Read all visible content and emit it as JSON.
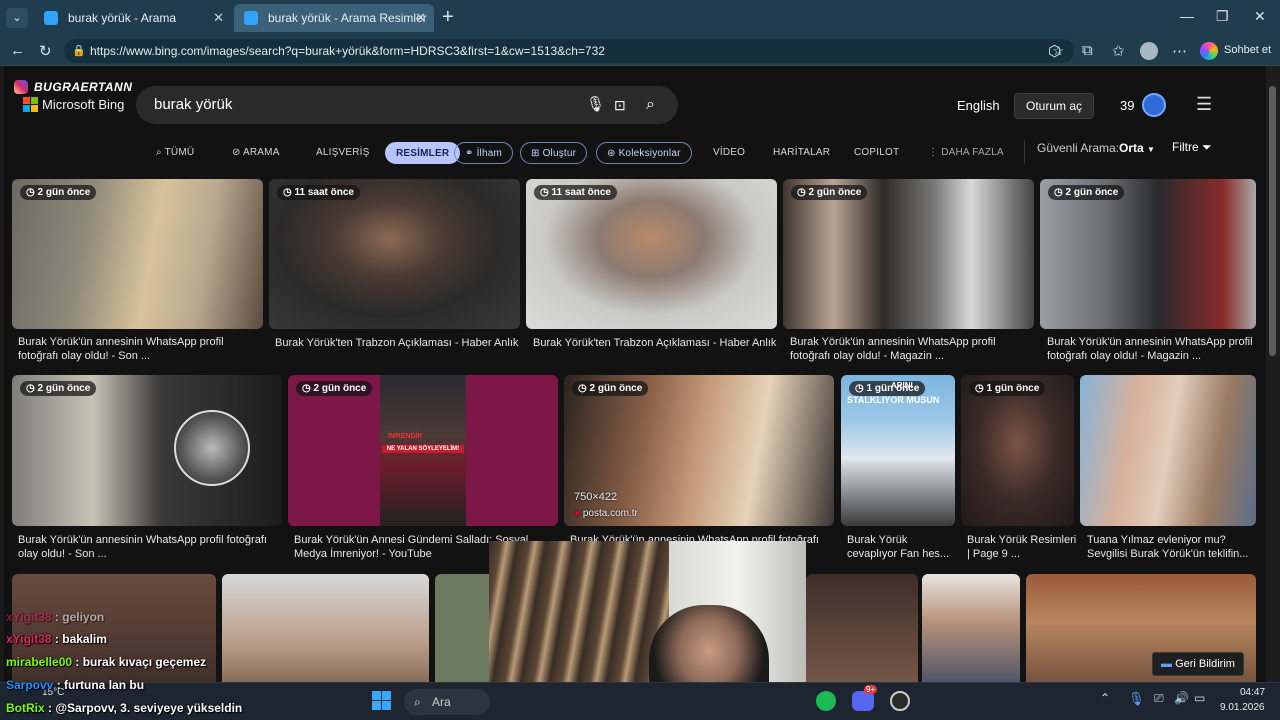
{
  "browser": {
    "tabs": [
      {
        "label": "burak yörük - Arama"
      },
      {
        "label": "burak yörük - Arama Resimler"
      }
    ],
    "url": "https://www.bing.com/images/search?q=burak+yörük&form=HDRSC3&first=1&cw=1513&ch=732",
    "copilot_label": "Sohbet et"
  },
  "overlay": {
    "streamer_name": "BUGRAERTANN"
  },
  "bing": {
    "logo_text": "Microsoft Bing",
    "search_query": "burak yörük",
    "language_link": "English",
    "signin_button": "Oturum aç",
    "rewards_count": "39",
    "nav": {
      "all": "TÜMÜ",
      "search": "ARAMA",
      "shopping": "ALIŞVERİŞ",
      "images": "RESİMLER",
      "inspiration": "İlham",
      "create": "Oluştur",
      "collections": "Koleksiyonlar",
      "video": "VİDEO",
      "maps": "HARİTALAR",
      "copilot": "COPILOT",
      "more": "DAHA FAZLA"
    },
    "safesearch_label": "Güvenli Arama:",
    "safesearch_value": "Orta",
    "filter_label": "Filtre"
  },
  "results_row1": [
    {
      "badge": "2 gün önce",
      "caption": "Burak Yörük'ün annesinin WhatsApp profil fotoğrafı olay oldu! - Son ..."
    },
    {
      "badge": "11 saat önce",
      "caption": "Burak Yörük'ten Trabzon Açıklaması - Haber Anlık"
    },
    {
      "badge": "11 saat önce",
      "caption": "Burak Yörük'ten Trabzon Açıklaması - Haber Anlık"
    },
    {
      "badge": "2 gün önce",
      "caption": "Burak Yörük'ün annesinin WhatsApp profil fotoğrafı olay oldu! - Magazin ..."
    },
    {
      "badge": "2 gün önce",
      "caption": "Burak Yörük'ün annesinin WhatsApp profil fotoğrafı olay oldu! - Magazin ..."
    }
  ],
  "results_row2": [
    {
      "badge": "2 gün önce",
      "caption": "Burak Yörük'ün annesinin WhatsApp profil fotoğrafı olay oldu! - Son ..."
    },
    {
      "badge": "2 gün önce",
      "caption": "Burak Yörük'ün Annesi Gündemi Salladı: Sosyal Medya İmreniyor! - YouTube"
    },
    {
      "badge": "2 gün önce",
      "caption": "Burak Yörük'ün annesinin WhatsApp profil fotoğrafı",
      "dimensions": "750×422",
      "source": "posta.com.tr"
    },
    {
      "badge": "1 gün önce",
      "caption": "Burak Yörük cevaplıyor Fan hes..."
    },
    {
      "badge": "1 gün önce",
      "caption": "Burak Yörük Resimleri | Page 9 ..."
    },
    {
      "badge": "",
      "caption": "Tuana Yılmaz evleniyor mu? Sevgilisi Burak Yörük'ün teklifin..."
    }
  ],
  "thumb_texts": {
    "ne_yalan": "NE YALAN SÖYLEYELİM!",
    "imrendik": "İMRENDİK",
    "stalkliyor": "STALKLIYOR MUSUN",
    "arini": "ARINI"
  },
  "feedback_button": "Geri Bildirim",
  "chat": [
    {
      "user": "xYigit38",
      "message": "geliyon",
      "color": "#e0245e"
    },
    {
      "user": "xYigit38",
      "message": "bakalim",
      "color": "#e0245e"
    },
    {
      "user": "mirabelle00",
      "message": "burak kıvaçı geçemez",
      "color": "#7cfc00"
    },
    {
      "user": "Sarpovv",
      "message": "furtuna lan bu",
      "color": "#1e90ff"
    },
    {
      "user": "BotRix",
      "message": "@Sarpovv, 3. seviyeye yükseldin",
      "color": "#7cfc00"
    }
  ],
  "taskbar": {
    "weather": "15°C",
    "search_placeholder": "Ara",
    "time": "04:47",
    "date": "9.01.2026",
    "discord_badge": "9+"
  }
}
